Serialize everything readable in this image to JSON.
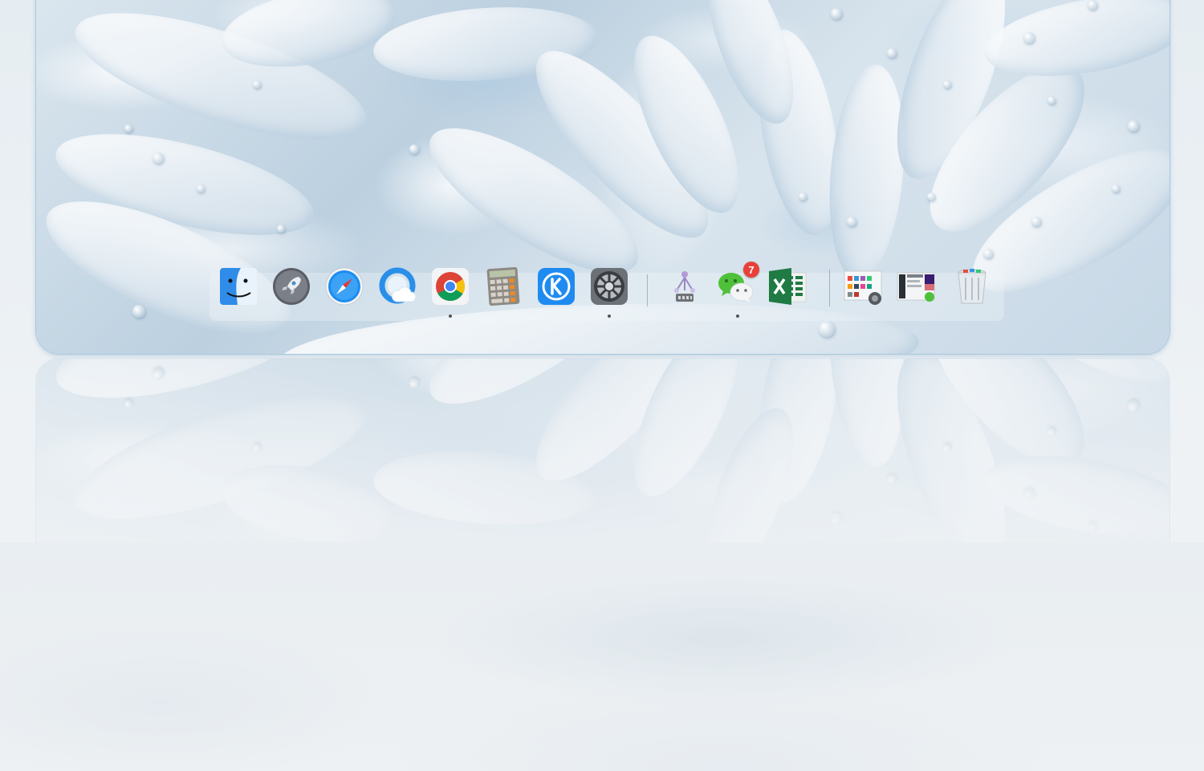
{
  "dock": {
    "apps": [
      {
        "name": "finder-icon",
        "running": false
      },
      {
        "name": "launchpad-icon",
        "running": false
      },
      {
        "name": "safari-icon",
        "running": false
      },
      {
        "name": "cloud-app-icon",
        "running": false
      },
      {
        "name": "chrome-icon",
        "running": true
      },
      {
        "name": "calculator-icon",
        "running": false
      },
      {
        "name": "kugou-music-icon",
        "running": false
      },
      {
        "name": "system-preferences-icon",
        "running": true
      },
      {
        "name": "network-utility-icon",
        "running": false
      },
      {
        "name": "wechat-icon",
        "running": true,
        "badge": "7"
      },
      {
        "name": "excel-icon",
        "running": false
      },
      {
        "name": "document-stack-icon",
        "running": false
      },
      {
        "name": "screenshot-stack-icon",
        "running": false
      },
      {
        "name": "trash-icon",
        "running": false
      }
    ],
    "wechat_badge": "7"
  },
  "colors": {
    "screen_border": "#a9c9de",
    "badge": "#e8413a",
    "finder_blue": "#2f8ce8",
    "excel_green": "#1f7a43",
    "chrome_red": "#db4437",
    "chrome_yellow": "#f4c20d",
    "chrome_green": "#0f9d58",
    "chrome_blue": "#4285f4"
  }
}
